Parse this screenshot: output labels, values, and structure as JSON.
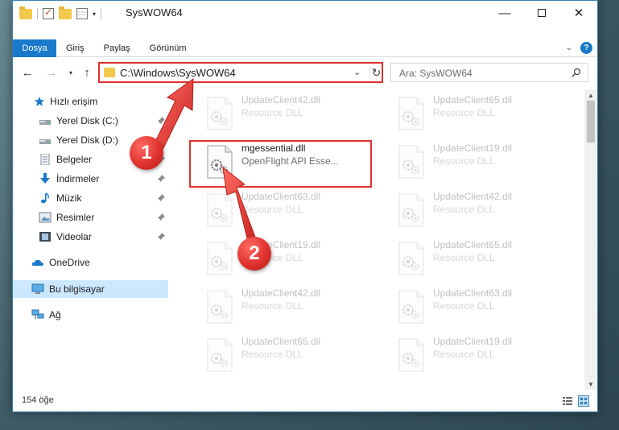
{
  "window": {
    "title": "SysWOW64",
    "controls": {
      "minimize": "—",
      "close": "✕"
    }
  },
  "ribbon": {
    "tabs": [
      "Dosya",
      "Giriş",
      "Paylaş",
      "Görünüm"
    ],
    "help": "?"
  },
  "navigation": {
    "address": "C:\\Windows\\SysWOW64",
    "search_placeholder": "Ara: SysWOW64"
  },
  "sidebar": {
    "items": [
      {
        "label": "Hızlı erişim",
        "icon": "star-icon"
      },
      {
        "label": "Yerel Disk (C:)",
        "icon": "drive-icon",
        "pinned": true
      },
      {
        "label": "Yerel Disk (D:)",
        "icon": "drive-icon",
        "pinned": true
      },
      {
        "label": "Belgeler",
        "icon": "documents-icon",
        "pinned": true
      },
      {
        "label": "İndirmeler",
        "icon": "downloads-icon",
        "pinned": true
      },
      {
        "label": "Müzik",
        "icon": "music-icon",
        "pinned": true
      },
      {
        "label": "Resimler",
        "icon": "pictures-icon",
        "pinned": true
      },
      {
        "label": "Videolar",
        "icon": "videos-icon",
        "pinned": true
      },
      {
        "label": "OneDrive",
        "icon": "cloud-icon"
      },
      {
        "label": "Bu bilgisayar",
        "icon": "computer-icon",
        "selected": true
      },
      {
        "label": "Ağ",
        "icon": "network-icon"
      }
    ]
  },
  "files": [
    {
      "name": "UpdateClient42.dll",
      "desc": "Resource DLL"
    },
    {
      "name": "UpdateClient65.dll",
      "desc": "Resource DLL"
    },
    {
      "name": "mgessential.dll",
      "desc": "OpenFlight API Esse...",
      "highlighted": true
    },
    {
      "name": "UpdateClient19.dll",
      "desc": "Resource DLL"
    },
    {
      "name": "UpdateClient63.dll",
      "desc": "Resource DLL"
    },
    {
      "name": "UpdateClient42.dll",
      "desc": "Resource DLL"
    },
    {
      "name": "UpdateClient19.dll",
      "desc": "Resource DLL"
    },
    {
      "name": "UpdateClient65.dll",
      "desc": "Resource DLL"
    },
    {
      "name": "UpdateClient42.dll",
      "desc": "Resource DLL"
    },
    {
      "name": "UpdateClient63.dll",
      "desc": "Resource DLL"
    },
    {
      "name": "UpdateClient65.dll",
      "desc": "Resource DLL"
    },
    {
      "name": "UpdateClient19.dll",
      "desc": "Resource DLL"
    }
  ],
  "status": {
    "item_count": "154 öğe"
  },
  "annotations": {
    "step1": "1",
    "step2": "2",
    "color": "#e0322e"
  }
}
